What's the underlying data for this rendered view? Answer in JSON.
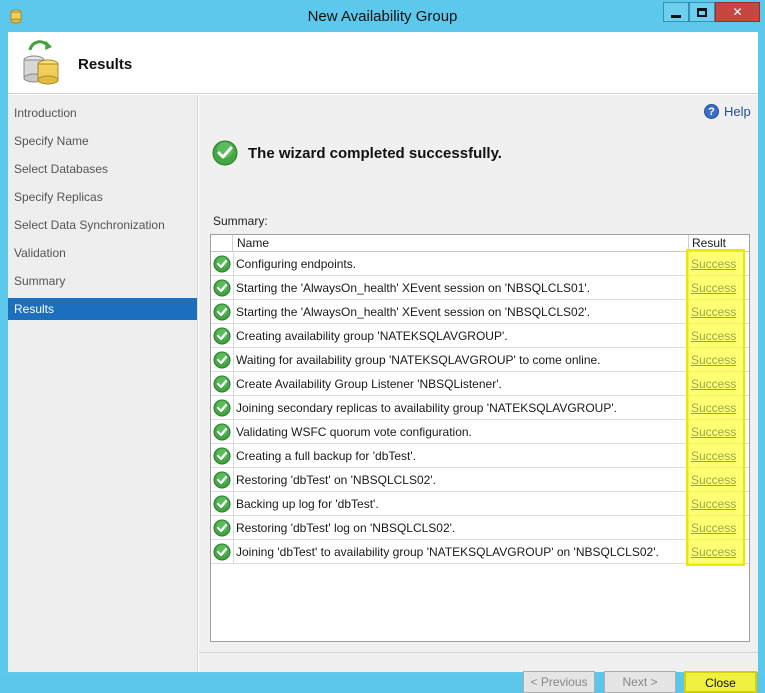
{
  "window": {
    "title": "New Availability Group"
  },
  "header": {
    "title": "Results"
  },
  "sidebar": {
    "items": [
      {
        "label": "Introduction",
        "active": false
      },
      {
        "label": "Specify Name",
        "active": false
      },
      {
        "label": "Select Databases",
        "active": false
      },
      {
        "label": "Specify Replicas",
        "active": false
      },
      {
        "label": "Select Data Synchronization",
        "active": false
      },
      {
        "label": "Validation",
        "active": false
      },
      {
        "label": "Summary",
        "active": false
      },
      {
        "label": "Results",
        "active": true
      }
    ]
  },
  "main": {
    "help_label": "Help",
    "completion_message": "The wizard completed successfully.",
    "summary_label": "Summary:",
    "columns": {
      "name": "Name",
      "result": "Result"
    },
    "rows": [
      {
        "name": "Configuring endpoints.",
        "result": "Success"
      },
      {
        "name": "Starting the 'AlwaysOn_health' XEvent session on 'NBSQLCLS01'.",
        "result": "Success"
      },
      {
        "name": "Starting the 'AlwaysOn_health' XEvent session on 'NBSQLCLS02'.",
        "result": "Success"
      },
      {
        "name": "Creating availability group 'NATEKSQLAVGROUP'.",
        "result": "Success"
      },
      {
        "name": "Waiting for availability group 'NATEKSQLAVGROUP' to come online.",
        "result": "Success"
      },
      {
        "name": "Create Availability Group Listener 'NBSQListener'.",
        "result": "Success"
      },
      {
        "name": "Joining secondary replicas to availability group 'NATEKSQLAVGROUP'.",
        "result": "Success"
      },
      {
        "name": "Validating WSFC quorum vote configuration.",
        "result": "Success"
      },
      {
        "name": "Creating a full backup for 'dbTest'.",
        "result": "Success"
      },
      {
        "name": "Restoring 'dbTest' on 'NBSQLCLS02'.",
        "result": "Success"
      },
      {
        "name": "Backing up log for 'dbTest'.",
        "result": "Success"
      },
      {
        "name": "Restoring 'dbTest' log on 'NBSQLCLS02'.",
        "result": "Success"
      },
      {
        "name": "Joining 'dbTest' to availability group 'NATEKSQLAVGROUP' on 'NBSQLCLS02'.",
        "result": "Success"
      }
    ]
  },
  "footer": {
    "previous_label": "< Previous",
    "next_label": "Next >",
    "close_label": "Close"
  },
  "colors": {
    "titlebar": "#5cc8ec",
    "selected_nav": "#1b6fbd",
    "link": "#1a3f9f",
    "success_green": "#3c9a3c",
    "highlight_yellow": "#ffff00"
  },
  "icons": {
    "app": "database-app-icon",
    "header": "database-sync-icon",
    "help": "help-icon",
    "status": "check-circle-icon"
  }
}
